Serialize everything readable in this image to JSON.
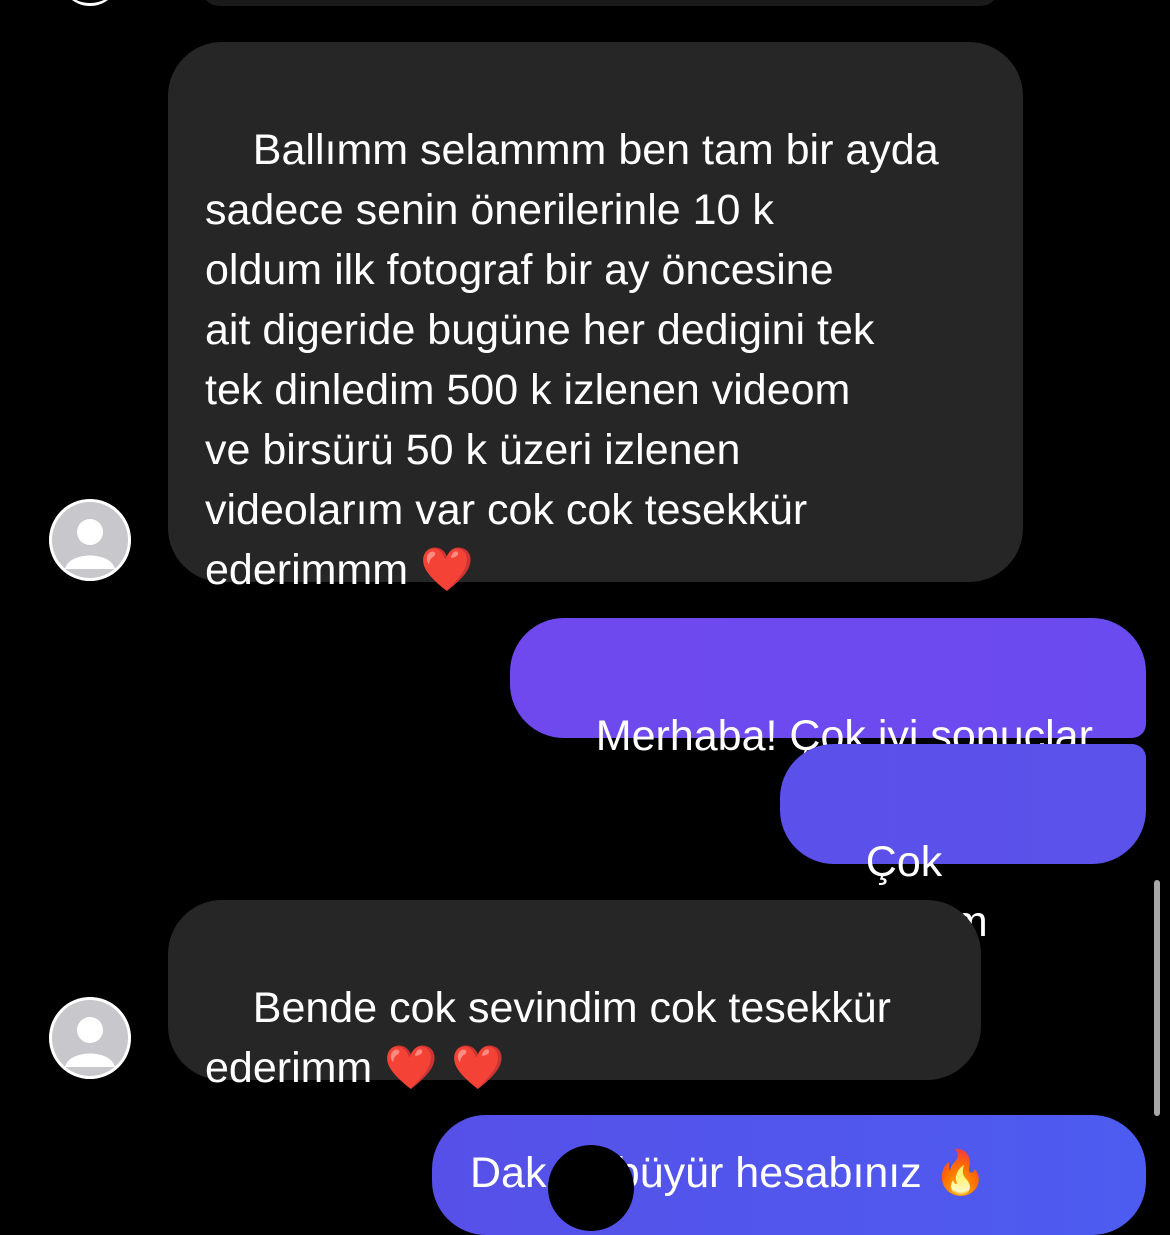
{
  "colors": {
    "background": "#000000",
    "incoming_bubble": "#262626",
    "outgoing_gradient_start": "#6a4bf0",
    "outgoing_gradient_end": "#5752e8",
    "text": "#ffffff"
  },
  "messages": [
    {
      "direction": "incoming",
      "text": "Ballımm selammm ben tam bir ayda\nsadece senin önerilerinle 10 k\noldum ilk fotograf bir ay öncesine\nait digeride bugüne her dedigini tek\ntek dinledim 500 k izlenen videom\nve birsürü 50 k üzeri izlenen\nvideolarım var cok cok tesekkür\nederimmm ",
      "emoji": "❤️"
    },
    {
      "direction": "outgoing",
      "text": "Merhaba! Çok iyi sonuçlar"
    },
    {
      "direction": "outgoing",
      "text": "Çok sevindim"
    },
    {
      "direction": "incoming",
      "text": "Bende cok sevindim cok tesekkür\nederimm ",
      "emoji": "❤️ ❤️"
    },
    {
      "direction": "outgoing",
      "text": "Dak      ok büyür hesabınız 🔥",
      "partial": true
    }
  ],
  "avatar_icon": "default-user-avatar-icon",
  "flame_icon": "fire-icon"
}
